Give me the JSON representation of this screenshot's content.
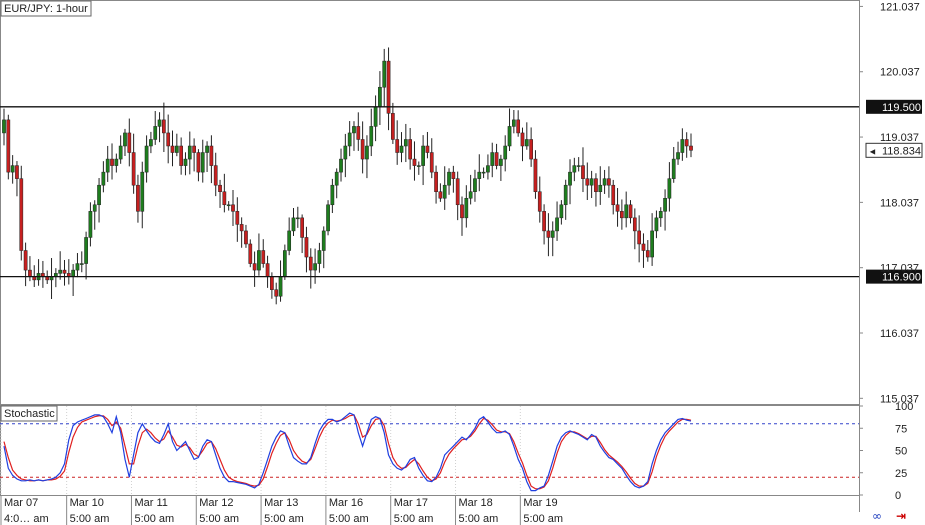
{
  "chart_data": {
    "type": "candlestick",
    "title": "EUR/JPY: 1-hour",
    "indicator_title": "Stochastic",
    "price_axis": {
      "ylim": [
        114.95,
        121.12
      ],
      "ticks": [
        121.037,
        120.037,
        119.037,
        118.037,
        117.037,
        116.037,
        115.037
      ]
    },
    "levels": [
      {
        "value": 119.5,
        "label": "119.500"
      },
      {
        "value": 116.9,
        "label": "116.900"
      }
    ],
    "last_price": {
      "value": 118.834,
      "label": "118.834"
    },
    "date_labels": [
      "Mar 07",
      "Mar 10",
      "Mar 11",
      "Mar 12",
      "Mar 13",
      "Mar 16",
      "Mar 17",
      "Mar 18",
      "Mar 19"
    ],
    "time_labels": [
      "4:0… am",
      "5:00 am",
      "5:00 am",
      "5:00 am",
      "5:00 am",
      "5:00 am",
      "5:00 am",
      "5:00 am",
      "5:00 am"
    ],
    "candles_per_day": 15,
    "closes": [
      119.3,
      118.5,
      118.6,
      118.4,
      117.3,
      117.0,
      116.9,
      116.85,
      116.95,
      116.9,
      116.85,
      116.9,
      116.95,
      117.0,
      116.95,
      116.9,
      117.0,
      117.1,
      117.1,
      117.5,
      117.9,
      118.0,
      118.3,
      118.5,
      118.7,
      118.6,
      118.7,
      118.9,
      119.1,
      118.8,
      118.3,
      117.9,
      118.5,
      118.9,
      119.0,
      119.2,
      119.3,
      119.1,
      118.9,
      118.8,
      118.9,
      118.6,
      118.7,
      118.9,
      118.8,
      118.5,
      118.8,
      118.9,
      118.6,
      118.3,
      118.2,
      118.0,
      118.0,
      117.9,
      117.7,
      117.6,
      117.4,
      117.1,
      117.0,
      117.3,
      117.1,
      116.9,
      116.7,
      116.6,
      116.9,
      117.3,
      117.6,
      117.8,
      117.8,
      117.5,
      117.2,
      117.0,
      117.1,
      117.3,
      117.6,
      118.0,
      118.3,
      118.5,
      118.7,
      118.9,
      119.1,
      119.2,
      119.0,
      118.7,
      118.9,
      119.2,
      119.5,
      119.8,
      120.2,
      119.4,
      119.0,
      118.8,
      118.9,
      119.0,
      118.7,
      118.6,
      118.6,
      118.9,
      118.8,
      118.5,
      118.2,
      118.1,
      118.3,
      118.5,
      118.4,
      118.0,
      117.8,
      118.1,
      118.2,
      118.4,
      118.5,
      118.5,
      118.6,
      118.8,
      118.6,
      118.7,
      118.9,
      119.2,
      119.3,
      119.1,
      118.9,
      119.0,
      118.7,
      118.2,
      117.9,
      117.6,
      117.5,
      117.6,
      117.8,
      118.0,
      118.3,
      118.5,
      118.6,
      118.6,
      118.4,
      118.3,
      118.4,
      118.2,
      118.3,
      118.4,
      118.3,
      118.0,
      117.9,
      117.8,
      118.0,
      117.8,
      117.6,
      117.4,
      117.3,
      117.2,
      117.6,
      117.8,
      117.9,
      118.1,
      118.4,
      118.7,
      118.8,
      119.0,
      118.9,
      118.834
    ],
    "stochastic": {
      "ylim": [
        0,
        100
      ],
      "ticks": [
        100,
        75,
        50,
        25,
        0
      ],
      "overbought": 80,
      "oversold": 20,
      "k": [
        55,
        30,
        22,
        18,
        16,
        16,
        17,
        16,
        17,
        16,
        17,
        18,
        20,
        25,
        35,
        62,
        78,
        82,
        84,
        86,
        88,
        90,
        90,
        88,
        80,
        70,
        88,
        70,
        40,
        20,
        45,
        70,
        80,
        72,
        65,
        60,
        58,
        68,
        80,
        60,
        50,
        55,
        60,
        50,
        40,
        42,
        55,
        62,
        60,
        45,
        30,
        20,
        15,
        15,
        14,
        13,
        12,
        10,
        8,
        12,
        25,
        40,
        55,
        65,
        72,
        70,
        55,
        42,
        38,
        35,
        35,
        42,
        58,
        72,
        80,
        85,
        85,
        82,
        84,
        88,
        92,
        90,
        70,
        55,
        70,
        85,
        88,
        86,
        70,
        45,
        35,
        30,
        28,
        32,
        40,
        42,
        30,
        22,
        16,
        15,
        20,
        30,
        45,
        50,
        55,
        60,
        65,
        62,
        68,
        75,
        85,
        88,
        82,
        75,
        70,
        70,
        72,
        68,
        55,
        40,
        30,
        15,
        5,
        5,
        8,
        10,
        22,
        38,
        55,
        65,
        70,
        72,
        70,
        68,
        65,
        62,
        68,
        65,
        55,
        48,
        42,
        40,
        35,
        30,
        22,
        15,
        10,
        8,
        10,
        15,
        35,
        50,
        62,
        70,
        75,
        80,
        85,
        86,
        84,
        83
      ],
      "d": [
        60,
        42,
        28,
        22,
        18,
        17,
        16,
        16,
        17,
        16,
        17,
        17,
        18,
        21,
        27,
        48,
        65,
        76,
        82,
        84,
        86,
        88,
        89,
        89,
        85,
        78,
        82,
        75,
        55,
        35,
        35,
        55,
        70,
        74,
        70,
        64,
        60,
        63,
        72,
        65,
        56,
        54,
        57,
        53,
        46,
        43,
        50,
        58,
        60,
        52,
        40,
        28,
        20,
        17,
        15,
        14,
        13,
        11,
        10,
        11,
        18,
        32,
        47,
        58,
        67,
        70,
        62,
        50,
        43,
        38,
        36,
        40,
        52,
        65,
        75,
        81,
        84,
        83,
        84,
        86,
        89,
        90,
        80,
        65,
        68,
        78,
        85,
        86,
        78,
        58,
        42,
        34,
        30,
        31,
        36,
        40,
        35,
        27,
        20,
        16,
        18,
        25,
        37,
        46,
        52,
        57,
        62,
        63,
        66,
        72,
        80,
        86,
        84,
        79,
        73,
        71,
        71,
        69,
        60,
        47,
        36,
        22,
        10,
        7,
        7,
        9,
        16,
        30,
        47,
        60,
        67,
        71,
        71,
        69,
        66,
        63,
        66,
        66,
        59,
        51,
        45,
        41,
        37,
        32,
        26,
        19,
        13,
        10,
        10,
        13,
        26,
        43,
        56,
        66,
        72,
        77,
        82,
        85,
        85,
        84
      ]
    }
  }
}
